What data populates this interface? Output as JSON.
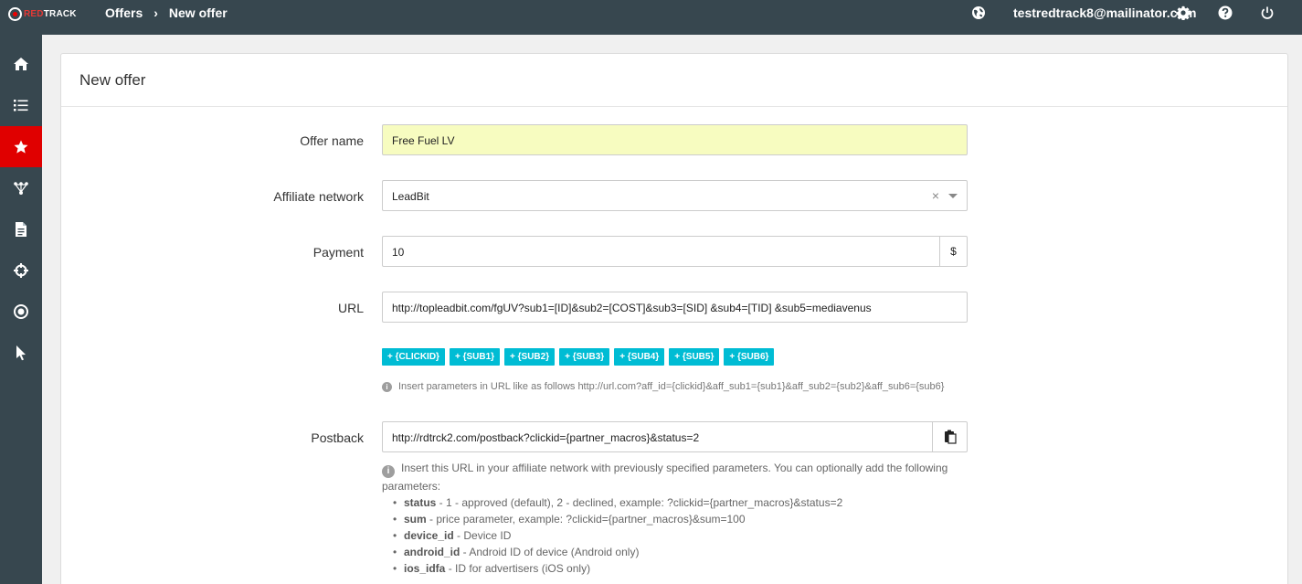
{
  "logo": {
    "red": "RED",
    "white": "TRACK"
  },
  "breadcrumb": {
    "section": "Offers",
    "separator": "›",
    "current": "New offer"
  },
  "topbar": {
    "user_email": "testredtrack8@mailinator.com"
  },
  "sidebar": {
    "items": [
      {
        "icon": "home-icon"
      },
      {
        "icon": "list-icon"
      },
      {
        "icon": "star-icon",
        "active": true
      },
      {
        "icon": "network-icon"
      },
      {
        "icon": "document-icon"
      },
      {
        "icon": "crosshair-icon"
      },
      {
        "icon": "target-icon"
      },
      {
        "icon": "cursor-icon"
      }
    ]
  },
  "panel": {
    "title": "New offer"
  },
  "form": {
    "offer_name": {
      "label": "Offer name",
      "value": "Free Fuel LV"
    },
    "affiliate_network": {
      "label": "Affiliate network",
      "value": "LeadBit",
      "clear": "×"
    },
    "payment": {
      "label": "Payment",
      "value": "10",
      "currency": "$"
    },
    "url": {
      "label": "URL",
      "value": "http://topleadbit.com/fgUV?sub1=[ID]&sub2=[COST]&sub3=[SID] &sub4=[TID] &sub5=mediavenus",
      "tags": [
        "+ {CLICKID}",
        "+ {SUB1}",
        "+ {SUB2}",
        "+ {SUB3}",
        "+ {SUB4}",
        "+ {SUB5}",
        "+ {SUB6}"
      ],
      "hint": "Insert parameters in URL like as follows http://url.com?aff_id={clickid}&aff_sub1={sub1}&aff_sub2={sub2}&aff_sub6={sub6}"
    },
    "postback": {
      "label": "Postback",
      "value": "http://rdtrck2.com/postback?clickid={partner_macros}&status=2",
      "help_intro": "Insert this URL in your affiliate network with previously specified parameters. You can optionally add the following parameters:",
      "params": [
        {
          "name": "status",
          "desc": " - 1 - approved (default), 2 - declined, example: ?clickid={partner_macros}&status=2"
        },
        {
          "name": "sum",
          "desc": " - price parameter, example: ?clickid={partner_macros}&sum=100"
        },
        {
          "name": "device_id",
          "desc": " - Device ID"
        },
        {
          "name": "android_id",
          "desc": " - Android ID of device (Android only)"
        },
        {
          "name": "ios_idfa",
          "desc": " - ID for advertisers (iOS only)"
        }
      ]
    }
  },
  "colors": {
    "topbar": "#37474f",
    "active_nav": "#e00000",
    "tag": "#00bcd4",
    "highlight_field": "#f7fcc0"
  }
}
